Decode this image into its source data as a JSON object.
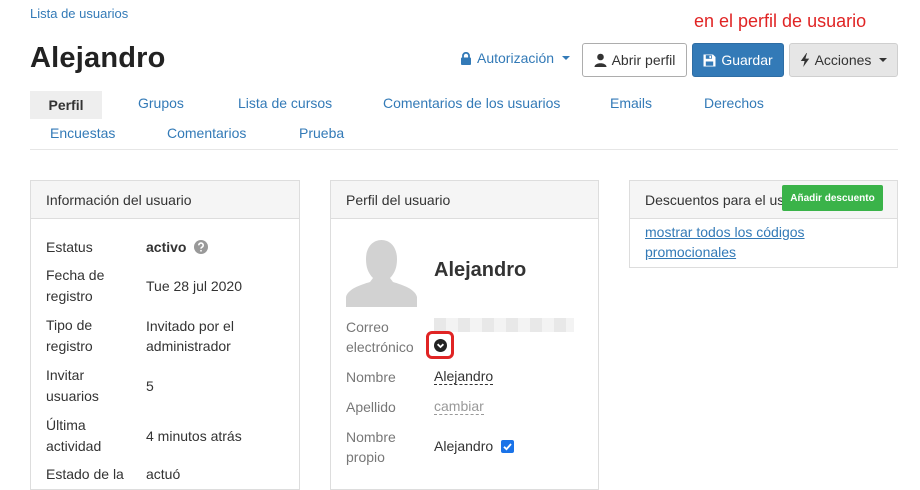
{
  "breadcrumb": {
    "label": "Lista de usuarios"
  },
  "annotation": {
    "text": "en el perfil de usuario",
    "color": "#e02424"
  },
  "page_title": "Alejandro",
  "header": {
    "auth_label": "Autorización",
    "open_profile_label": "Abrir perfil",
    "save_label": "Guardar",
    "actions_label": "Acciones"
  },
  "tabs": [
    {
      "label": "Perfil",
      "active": true
    },
    {
      "label": "Grupos"
    },
    {
      "label": "Lista de cursos"
    },
    {
      "label": "Comentarios de los usuarios"
    },
    {
      "label": "Emails"
    },
    {
      "label": "Derechos"
    },
    {
      "label": "Encuestas"
    },
    {
      "label": "Comentarios"
    },
    {
      "label": "Prueba"
    }
  ],
  "user_info": {
    "heading": "Información del usuario",
    "rows": [
      {
        "label": "Estatus",
        "value": "activo"
      },
      {
        "label": "Fecha de registro",
        "value": "Tue 28 jul 2020"
      },
      {
        "label": "Tipo de registro",
        "value": "Invitado por el administrador"
      },
      {
        "label": "Invitar usuarios",
        "value": "5"
      },
      {
        "label": "Última actividad",
        "value": "4 minutos atrás"
      },
      {
        "label": "Estado de la",
        "value": "actuó"
      }
    ]
  },
  "profile": {
    "heading": "Perfil del usuario",
    "name": "Alejandro",
    "email_label": "Correo electrónico",
    "first_name_label": "Nombre",
    "first_name_value": "Alejandro",
    "last_name_label": "Apellido",
    "last_name_value": "cambiar",
    "display_name_label": "Nombre propio",
    "display_name_value": "Alejandro"
  },
  "discounts": {
    "heading": "Descuentos para el usuario",
    "add_button": "Añadir descuento",
    "show_all_link": "mostrar todos los códigos promocionales"
  },
  "colors": {
    "link": "#337ab7",
    "primary": "#337ab7",
    "success": "#3ab349",
    "highlight": "#e02424"
  }
}
